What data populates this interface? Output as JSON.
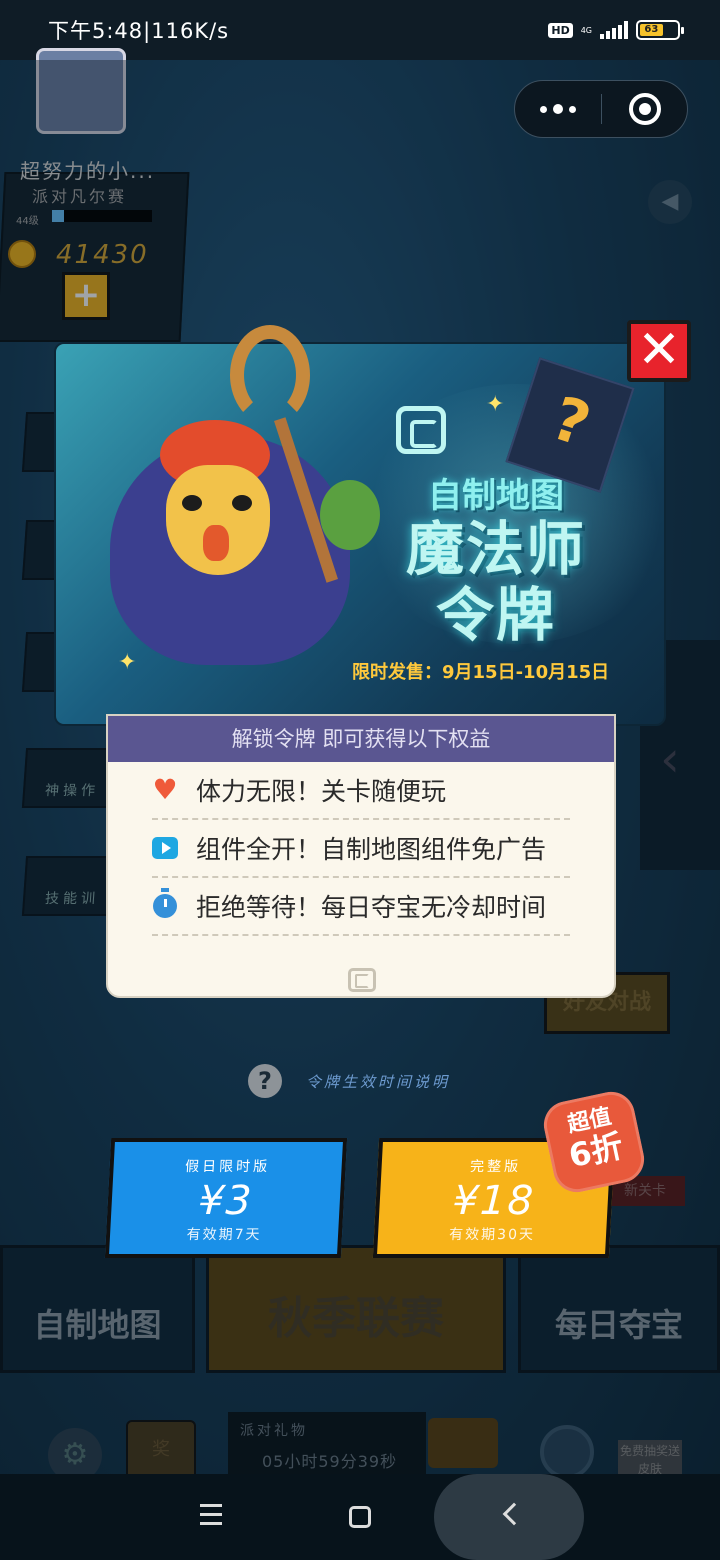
{
  "status_bar": {
    "time": "下午5:48",
    "speed": "116K/s",
    "hd": "HD",
    "network": "4G",
    "battery": "63"
  },
  "capsule": {
    "more_icon": "more-dots-icon",
    "close_icon": "target-close-icon"
  },
  "background": {
    "player_name": "超努力的小...",
    "player_rank": "派对凡尔赛",
    "player_level": "44级",
    "coins": "41430",
    "side_items": [
      "神操作",
      "技能训"
    ],
    "friend_battle": "好友对战",
    "bottom_cards": [
      "自制地图",
      "秋季联赛",
      "每日夺宝"
    ],
    "new_level": "新关卡",
    "gift_title": "派对礼物",
    "gift_timer": "05小时59分39秒",
    "tv_label": "奖",
    "free_draw": "免费抽奖送皮肤"
  },
  "modal": {
    "banner_title1": "自制地图",
    "banner_title2_line1": "魔法师",
    "banner_title2_line2": "令牌",
    "sale_text": "限时发售：9月15日-10月15日",
    "benefits_header": "解锁令牌 即可获得以下权益",
    "benefits": [
      {
        "icon": "heart-icon",
        "text": "体力无限！关卡随便玩"
      },
      {
        "icon": "play-icon",
        "text": "组件全开！自制地图组件免广告"
      },
      {
        "icon": "timer-icon",
        "text": "拒绝等待！每日夺宝无冷却时间"
      }
    ],
    "help_text": "令牌生效时间说明",
    "price_holiday": {
      "kind": "假日限时版",
      "value": "¥3",
      "duration": "有效期7天"
    },
    "price_full": {
      "kind": "完整版",
      "value": "¥18",
      "duration": "有效期30天"
    },
    "badge_line1": "超值",
    "badge_line2": "6折"
  },
  "colors": {
    "accent_red": "#e8232c",
    "blue_price": "#1a90e8",
    "yellow_price": "#f7b319",
    "header_purple": "#5a5691"
  }
}
